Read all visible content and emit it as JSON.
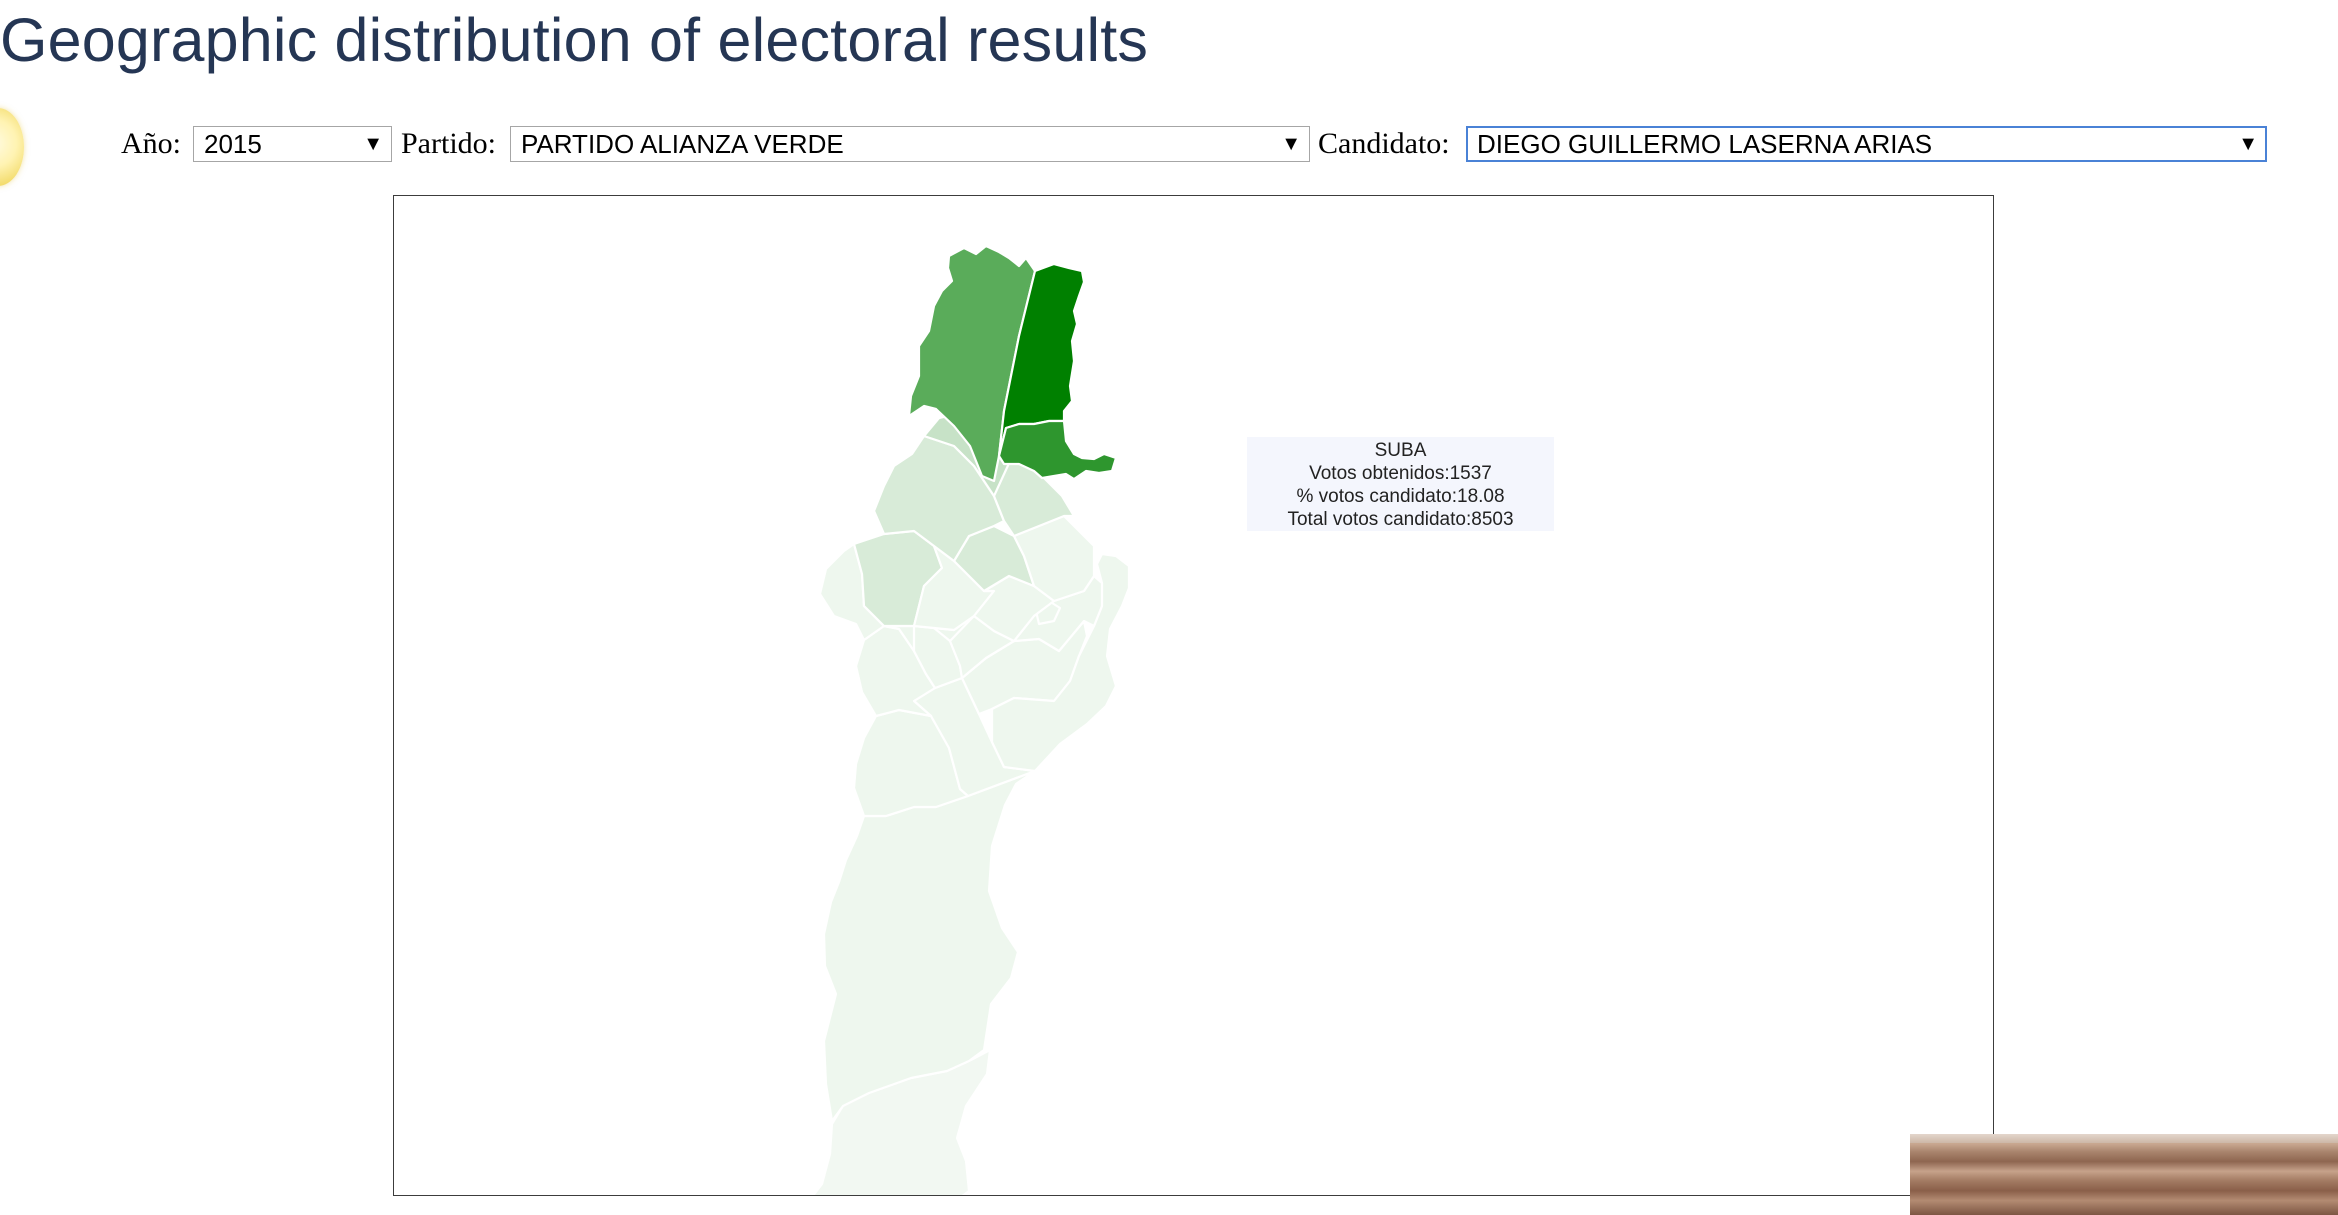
{
  "page": {
    "title": "Geographic distribution of electoral results"
  },
  "filters": {
    "year": {
      "label": "Año:",
      "selected": "2015"
    },
    "party": {
      "label": "Partido:",
      "selected": "PARTIDO ALIANZA VERDE"
    },
    "candidate": {
      "label": "Candidato:",
      "selected": "DIEGO GUILLERMO LASERNA ARIAS"
    }
  },
  "tooltip": {
    "district": "SUBA",
    "votes_line": "Votos obtenidos:1537",
    "percent_line": "% votos candidato:18.08",
    "total_line": "Total votos candidato:8503"
  },
  "map": {
    "highlighted_district": "SUBA",
    "color_scale": {
      "highest": "#008000",
      "high": "#2e962e",
      "medium": "#5aac5a",
      "low": "#c7e2c7",
      "lower": "#d7ead7",
      "lowest": "#edf6ed",
      "stroke": "#ffffff"
    }
  },
  "icons": {
    "logo": "sun-logo-icon",
    "dropdown": "triangle-down-icon"
  }
}
